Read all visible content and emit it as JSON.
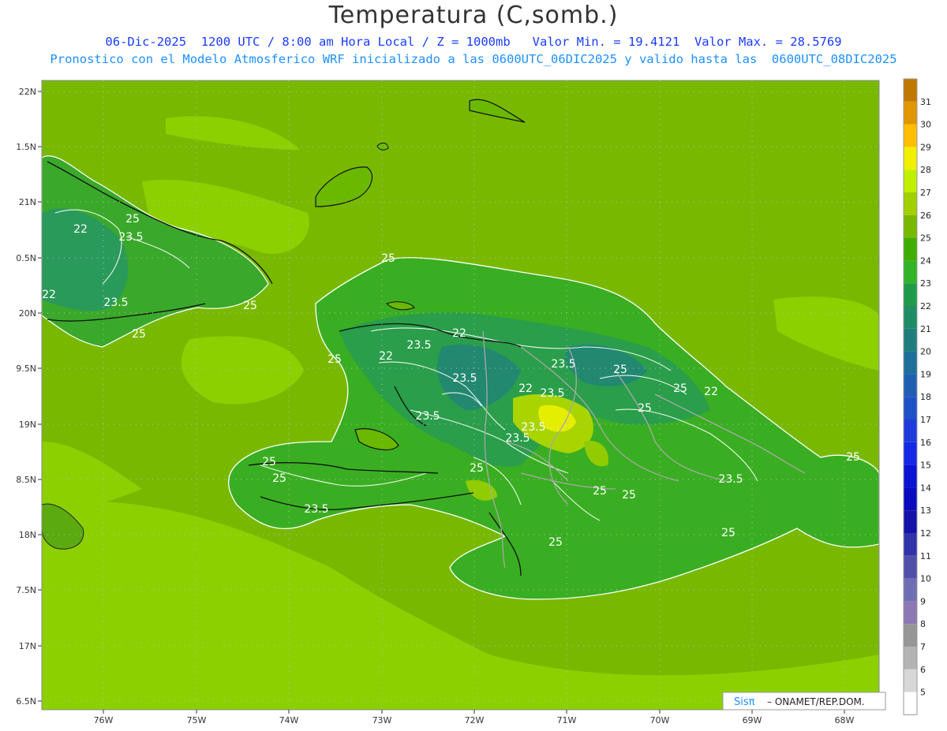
{
  "header": {
    "title": "Temperatura (C,somb.)",
    "line1": "06-Dic-2025  1200 UTC / 8:00 am Hora Local / Z = 1000mb   Valor Min. = 19.4121  Valor Max. = 28.5769",
    "line2": "Pronostico con el Modelo Atmosferico WRF inicializado a las 0600UTC_06DIC2025 y valido hasta las  0600UTC_08DIC2025"
  },
  "axes": {
    "lat_labels": [
      "22N",
      "1.5N",
      "21N",
      "0.5N",
      "20N",
      "9.5N",
      "19N",
      "8.5N",
      "18N",
      "7.5N",
      "17N",
      "6.5N"
    ],
    "lon_labels": [
      "76W",
      "75W",
      "74W",
      "73W",
      "72W",
      "71W",
      "70W",
      "69W",
      "68W"
    ]
  },
  "contour_labels": [
    "25",
    "22",
    "23.5",
    "22",
    "23.5",
    "25",
    "25",
    "25",
    "22",
    "23.5",
    "25",
    "22",
    "23.5",
    "25",
    "23.5",
    "22",
    "23.5",
    "25",
    "22",
    "25",
    "23.5",
    "25",
    "25",
    "23.5",
    "23.5",
    "25",
    "23.5",
    "25",
    "25",
    "25",
    "23.5",
    "25"
  ],
  "colorbar": {
    "labels": [
      "31",
      "30",
      "29",
      "28",
      "27",
      "26",
      "25",
      "24",
      "23",
      "22",
      "21",
      "20",
      "19",
      "18",
      "17",
      "16",
      "15",
      "14",
      "13",
      "12",
      "11",
      "10",
      "9",
      "8",
      "7",
      "6",
      "5"
    ],
    "colors": [
      "#c07800",
      "#e09600",
      "#ffbe00",
      "#f0f000",
      "#c0f000",
      "#a0d000",
      "#78b900",
      "#40ae00",
      "#32b428",
      "#1e9b46",
      "#1e8c64",
      "#1e7d7d",
      "#1e6e9b",
      "#1e5fb4",
      "#1e50c8",
      "#1e3cdc",
      "#1428e6",
      "#0a14d2",
      "#0a0abe",
      "#1414aa",
      "#3232aa",
      "#5050aa",
      "#6e6eb4",
      "#8c78b4",
      "#969696",
      "#b4b4b4",
      "#d7d7d7",
      "#ffffff"
    ]
  },
  "field_colors": {
    "ocean": "#78b900",
    "ocean_light": "#8cd000",
    "land_low": "#5aa800",
    "land": "#32aa22",
    "land_cool": "#22956a",
    "land_warm": "#b4d800",
    "peak": "#f0f000"
  },
  "credit": {
    "logo": "Sisπ",
    "text": "– ONAMET/REP.DOM."
  }
}
